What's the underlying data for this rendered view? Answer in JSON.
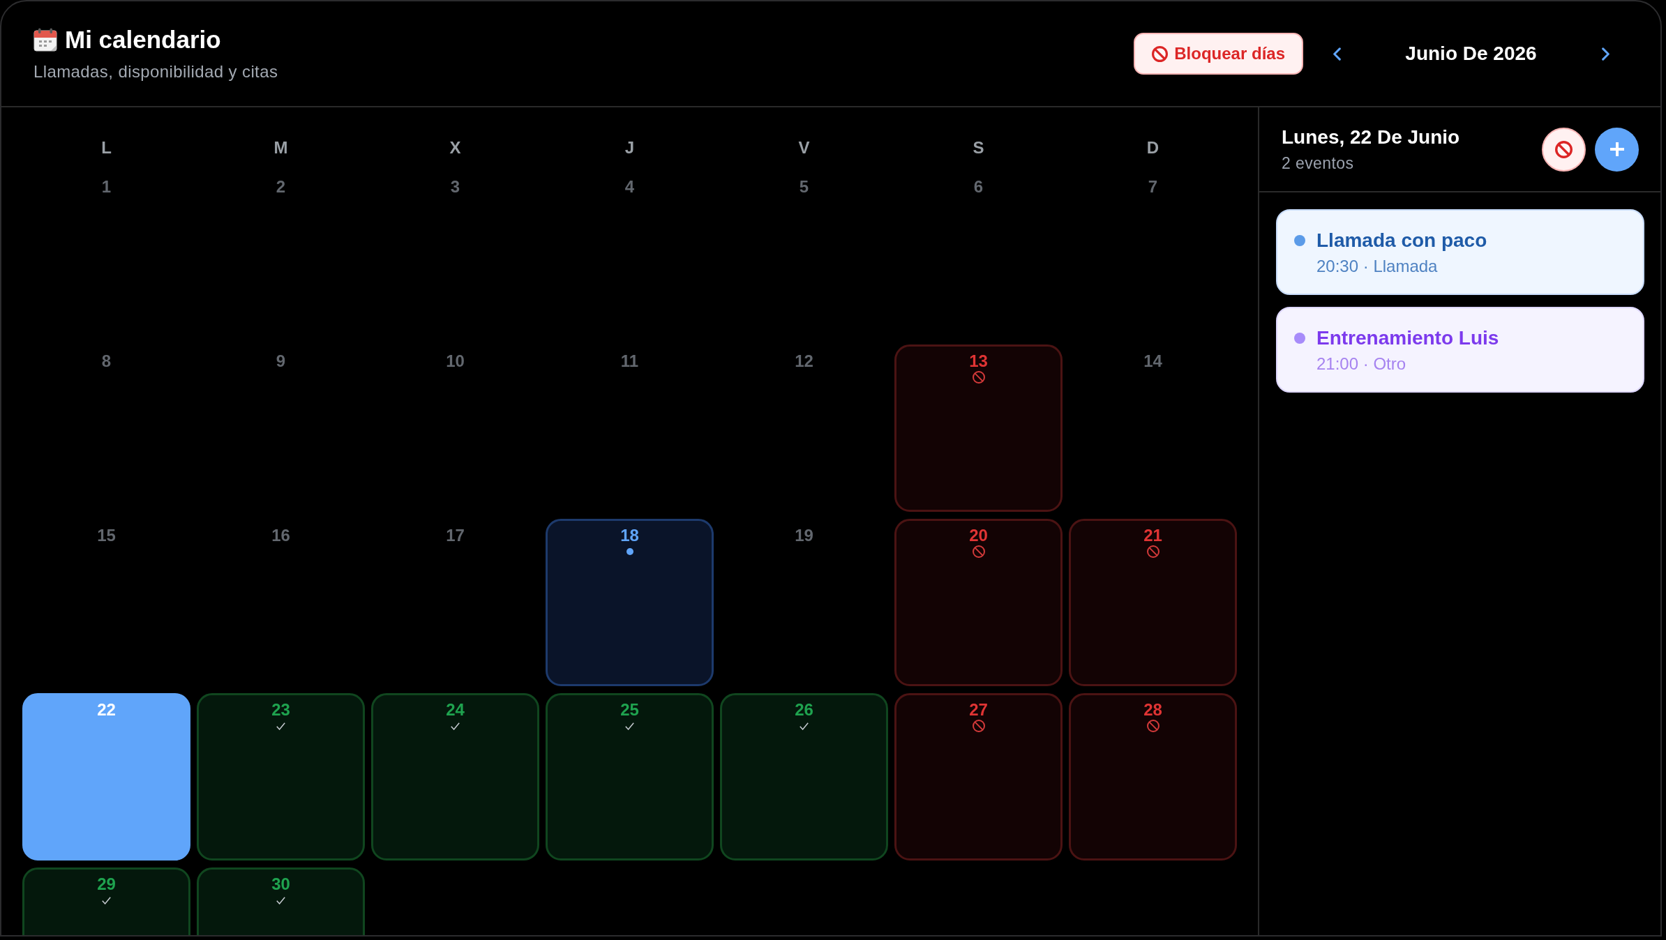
{
  "header": {
    "title": "Mi calendario",
    "subtitle": "Llamadas, disponibilidad y citas",
    "block_button": "Bloquear días",
    "month": "Junio De 2026"
  },
  "calendar": {
    "weekdays": [
      "L",
      "M",
      "X",
      "J",
      "V",
      "S",
      "D"
    ],
    "days": [
      {
        "day": "1",
        "kind": "plain",
        "selected": false
      },
      {
        "day": "2",
        "kind": "plain",
        "selected": false
      },
      {
        "day": "3",
        "kind": "plain",
        "selected": false
      },
      {
        "day": "4",
        "kind": "plain",
        "selected": false
      },
      {
        "day": "5",
        "kind": "plain",
        "selected": false
      },
      {
        "day": "6",
        "kind": "plain",
        "selected": false
      },
      {
        "day": "7",
        "kind": "plain",
        "selected": false
      },
      {
        "day": "8",
        "kind": "plain",
        "selected": false
      },
      {
        "day": "9",
        "kind": "plain",
        "selected": false
      },
      {
        "day": "10",
        "kind": "plain",
        "selected": false
      },
      {
        "day": "11",
        "kind": "plain",
        "selected": false
      },
      {
        "day": "12",
        "kind": "plain",
        "selected": false
      },
      {
        "day": "13",
        "kind": "blocked",
        "selected": false
      },
      {
        "day": "14",
        "kind": "plain",
        "selected": false
      },
      {
        "day": "15",
        "kind": "plain",
        "selected": false
      },
      {
        "day": "16",
        "kind": "plain",
        "selected": false
      },
      {
        "day": "17",
        "kind": "plain",
        "selected": false
      },
      {
        "day": "18",
        "kind": "event",
        "selected": false
      },
      {
        "day": "19",
        "kind": "plain",
        "selected": false
      },
      {
        "day": "20",
        "kind": "blocked",
        "selected": false
      },
      {
        "day": "21",
        "kind": "blocked",
        "selected": false
      },
      {
        "day": "22",
        "kind": "plain",
        "selected": true
      },
      {
        "day": "23",
        "kind": "available",
        "selected": false
      },
      {
        "day": "24",
        "kind": "available",
        "selected": false
      },
      {
        "day": "25",
        "kind": "available",
        "selected": false
      },
      {
        "day": "26",
        "kind": "available",
        "selected": false
      },
      {
        "day": "27",
        "kind": "blocked",
        "selected": false
      },
      {
        "day": "28",
        "kind": "blocked",
        "selected": false
      },
      {
        "day": "29",
        "kind": "available",
        "selected": false
      },
      {
        "day": "30",
        "kind": "available",
        "selected": false
      }
    ]
  },
  "day_panel": {
    "title": "Lunes, 22 De Junio",
    "count": "2 eventos",
    "events": [
      {
        "title": "Llamada con paco",
        "detail": "20:30 · Llamada",
        "kind": "call",
        "color": "#5b9be8"
      },
      {
        "title": "Entrenamiento Luis",
        "detail": "21:00 · Otro",
        "kind": "other",
        "color": "#a78bfa"
      }
    ]
  }
}
